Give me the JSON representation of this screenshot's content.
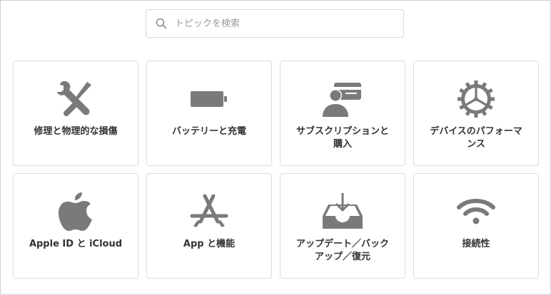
{
  "search": {
    "placeholder": "トピックを検索",
    "icon": "search-icon"
  },
  "colors": {
    "icon": "#7a7a7a",
    "text": "#333333",
    "border": "#dcdcdc"
  },
  "tiles": [
    {
      "label": "修理と物理的な損傷",
      "icon": "repair-tools-icon"
    },
    {
      "label": "バッテリーと充電",
      "icon": "battery-icon"
    },
    {
      "label": "サブスクリプションと\n購入",
      "icon": "subscription-person-card-icon"
    },
    {
      "label": "デバイスのパフォーマ\nンス",
      "icon": "gear-icon"
    },
    {
      "label": "Apple ID と iCloud",
      "icon": "apple-logo-icon"
    },
    {
      "label": "App と機能",
      "icon": "app-store-icon"
    },
    {
      "label": "アップデート／バック\nアップ／復元",
      "icon": "download-tray-icon"
    },
    {
      "label": "接続性",
      "icon": "wifi-icon"
    }
  ]
}
